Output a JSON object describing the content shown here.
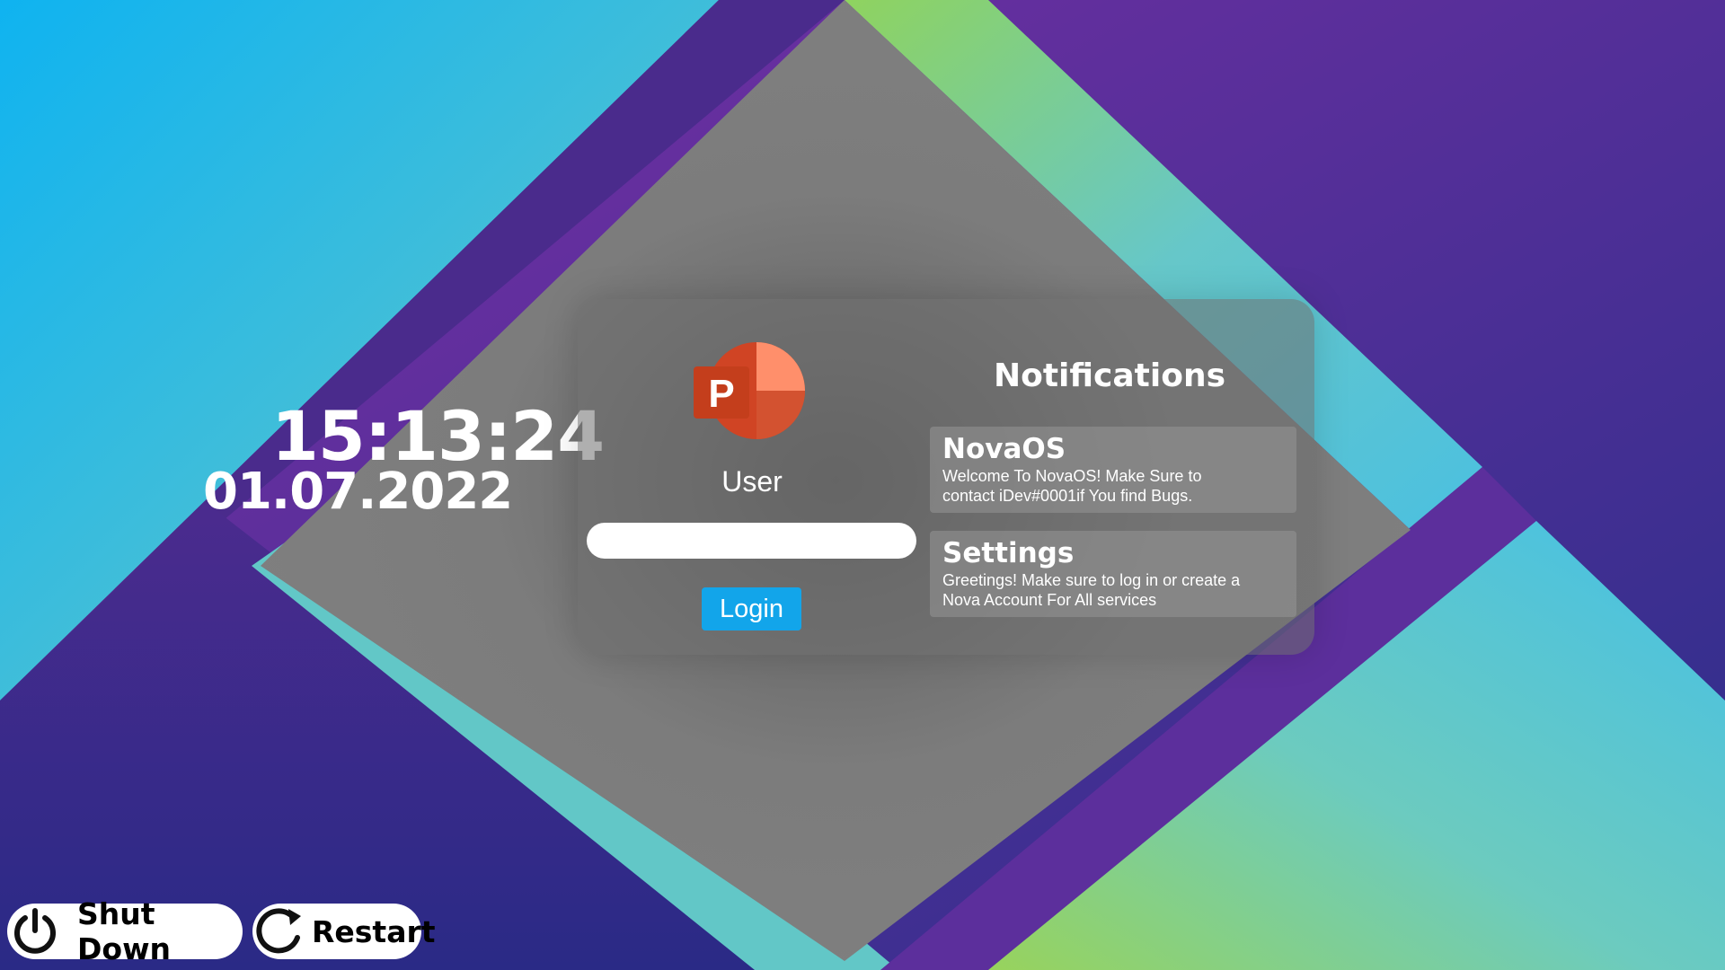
{
  "clock": {
    "time": "15:13:24",
    "date": "01.07.2022"
  },
  "login": {
    "app_icon": "powerpoint-logo",
    "username": "User",
    "password_value": "",
    "login_label": "Login"
  },
  "notifications": {
    "heading": "Notifications",
    "items": [
      {
        "title": "NovaOS",
        "body_line1": "Welcome To NovaOS! Make Sure to",
        "body_line2": "contact iDev#0001if You find Bugs."
      },
      {
        "title": "Settings",
        "body_line1": "Greetings! Make sure to log in or create a",
        "body_line2": "Nova Account For All services"
      }
    ]
  },
  "power": {
    "shutdown_label": "Shut Down",
    "shutdown_icon": "power-icon",
    "restart_label": "Restart",
    "restart_icon": "restart-icon"
  },
  "colors": {
    "accent": "#12a5ea",
    "purple": "#4a2a8c",
    "teal": "#5fc8c8",
    "green": "#8ed468",
    "panel": "#7e7e7e"
  }
}
